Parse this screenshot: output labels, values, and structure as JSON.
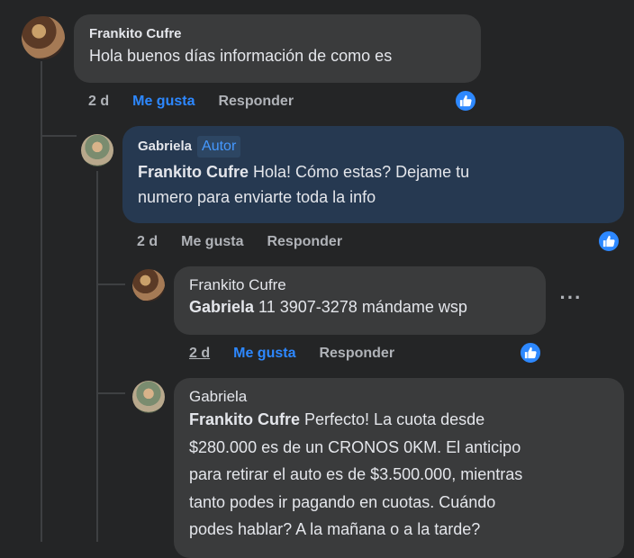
{
  "comments": [
    {
      "author": "Frankito Cufre",
      "text": "Hola buenos días información de como es",
      "time": "2 d",
      "like_label": "Me gusta",
      "reply_label": "Responder"
    },
    {
      "author": "Gabriela",
      "badge": "Autor",
      "mention": "Frankito Cufre",
      "text_line1": " Hola! Cómo estas? Dejame tu",
      "text_line2": "numero para enviarte toda la info",
      "time": "2 d",
      "like_label": "Me gusta",
      "reply_label": "Responder"
    },
    {
      "author": "Frankito Cufre",
      "mention": "Gabriela",
      "text": " 11 3907-3278 mándame wsp",
      "time": "2 d",
      "like_label": "Me gusta",
      "reply_label": "Responder",
      "more_label": "···"
    },
    {
      "author": "Gabriela",
      "mention": "Frankito Cufre",
      "text_line1": " Perfecto! La cuota desde",
      "text_line2": "$280.000 es de un CRONOS 0KM. El anticipo",
      "text_line3": "para retirar el auto es de $3.500.000, mientras",
      "text_line4": "tanto podes ir pagando en cuotas. Cuándo",
      "text_line5": "podes hablar? A la mañana o a la tarde?"
    }
  ],
  "colors": {
    "background": "#242526",
    "bubble": "#3a3b3c",
    "author_bubble": "#263951",
    "like_active": "#2d88ff"
  }
}
